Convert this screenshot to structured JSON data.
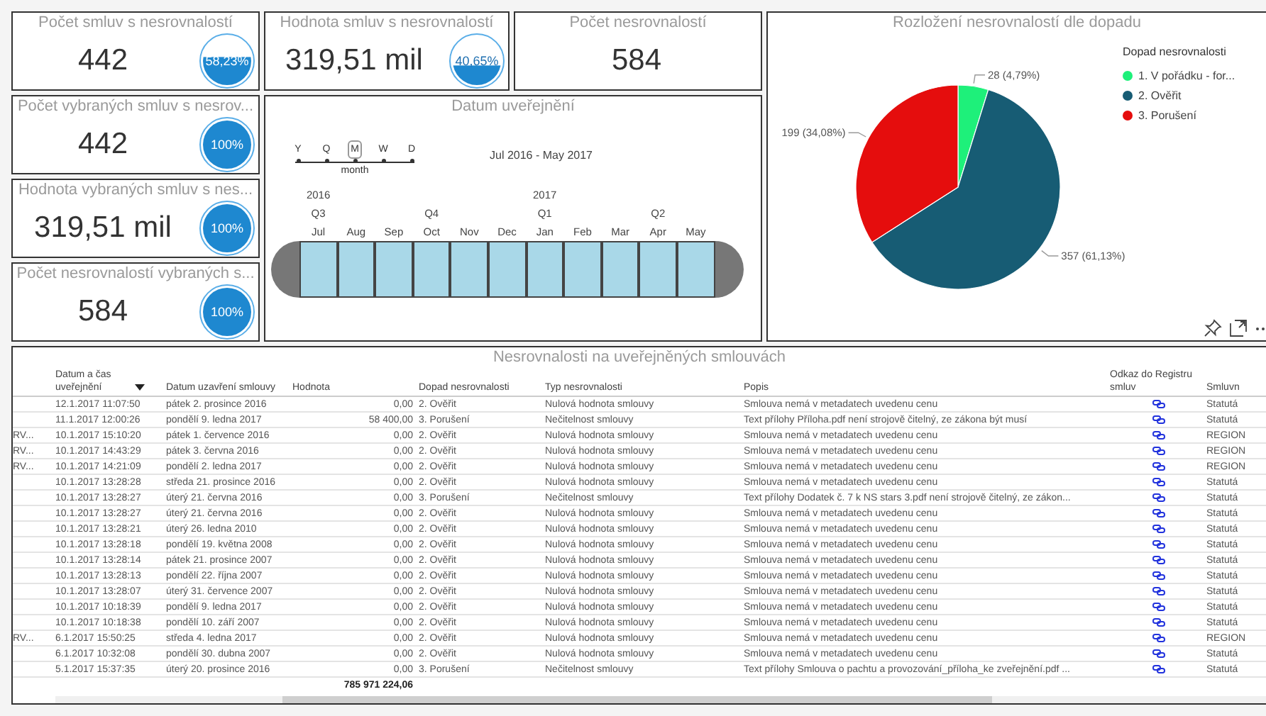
{
  "top_cards": [
    {
      "title": "Počet smluv s nesrovnalostí",
      "value": "442",
      "gauge": {
        "label": "58,23%"
      }
    },
    {
      "title": "Hodnota smluv s nesrovnalostí",
      "value": "319,51 mil",
      "gauge": {
        "label": "40,65%"
      }
    },
    {
      "title": "Počet nesrovnalostí",
      "value": "584"
    }
  ],
  "side_cards": [
    {
      "title": "Počet vybraných smluv s nesrov...",
      "value": "442",
      "gauge": {
        "label": "100%"
      }
    },
    {
      "title": "Hodnota vybraných smluv s nes...",
      "value": "319,51 mil",
      "gauge": {
        "label": "100%"
      }
    },
    {
      "title": "Počet nesrovnalostí vybraných s...",
      "value": "584",
      "gauge": {
        "label": "100%"
      }
    }
  ],
  "timeline": {
    "title": "Datum uveřejnění",
    "granularity": [
      {
        "label": "Y",
        "selected": false
      },
      {
        "label": "Q",
        "selected": false
      },
      {
        "label": "M",
        "selected": true
      },
      {
        "label": "W",
        "selected": false
      },
      {
        "label": "D",
        "selected": false
      }
    ],
    "granularity_caption": "month",
    "range": "Jul 2016 - May 2017",
    "months": [
      {
        "label": "Jul",
        "quarter": "Q3",
        "year": "2016",
        "selected": true
      },
      {
        "label": "Aug",
        "selected": true
      },
      {
        "label": "Sep",
        "selected": true
      },
      {
        "label": "Oct",
        "quarter": "Q4",
        "selected": true
      },
      {
        "label": "Nov",
        "selected": true
      },
      {
        "label": "Dec",
        "selected": true
      },
      {
        "label": "Jan",
        "quarter": "Q1",
        "year": "2017",
        "selected": true
      },
      {
        "label": "Feb",
        "selected": true
      },
      {
        "label": "Mar",
        "selected": true
      },
      {
        "label": "Apr",
        "quarter": "Q2",
        "selected": true
      },
      {
        "label": "May",
        "selected": true
      }
    ]
  },
  "pie": {
    "chart_data": {
      "type": "pie",
      "title": "Rozložení nesrovnalostí dle dopadu",
      "categories": [
        "1. V pořádku - for...",
        "2. Ověřit",
        "3. Porušení"
      ],
      "series": [
        {
          "name": "Dopad nesrovnalosti",
          "values": [
            4.79,
            61.13,
            34.08
          ]
        }
      ],
      "colors": [
        "#1ef07a",
        "#175c74",
        "#e50d0d"
      ],
      "value_labels": [
        "28 (4,79%)",
        "357 (61,13%)",
        "199 (34,08%)"
      ]
    }
  },
  "table": {
    "title": "Nesrovnalosti na uveřejněných smlouvách",
    "columns": [
      {
        "label": "Datum a čas uveřejnění",
        "sorted": true
      },
      {
        "label": "Datum uzavření smlouvy"
      },
      {
        "label": "Hodnota"
      },
      {
        "label": "Dopad nesrovnalosti"
      },
      {
        "label": "Typ nesrovnalosti"
      },
      {
        "label": "Popis"
      },
      {
        "label": "Odkaz do Registru smluv"
      },
      {
        "label": "Smluvn"
      }
    ],
    "rows": [
      {
        "cells": [
          "12.1.2017 11:07:50",
          "pátek 2. prosince 2016",
          "0,00",
          "2. Ověřit",
          "Nulová hodnota smlouvy",
          "Smlouva nemá v metadatech uvedenu cenu",
          "Statutá"
        ]
      },
      {
        "cells": [
          "11.1.2017 12:00:26",
          "pondělí 9. ledna 2017",
          "58 400,00",
          "3. Porušení",
          "Nečitelnost smlouvy",
          "Text přílohy Příloha.pdf není strojově čitelný, ze zákona být musí",
          "Statutá"
        ]
      },
      {
        "column_1": "RV...",
        "cells": [
          "10.1.2017 15:10:20",
          "pátek 1. července 2016",
          "0,00",
          "2. Ověřit",
          "Nulová hodnota smlouvy",
          "Smlouva nemá v metadatech uvedenu cenu",
          "REGION"
        ]
      },
      {
        "column_1": "RV...",
        "cells": [
          "10.1.2017 14:43:29",
          "pátek 3. června 2016",
          "0,00",
          "2. Ověřit",
          "Nulová hodnota smlouvy",
          "Smlouva nemá v metadatech uvedenu cenu",
          "REGION"
        ]
      },
      {
        "column_1": "RV...",
        "cells": [
          "10.1.2017 14:21:09",
          "pondělí 2. ledna 2017",
          "0,00",
          "2. Ověřit",
          "Nulová hodnota smlouvy",
          "Smlouva nemá v metadatech uvedenu cenu",
          "REGION"
        ]
      },
      {
        "cells": [
          "10.1.2017 13:28:28",
          "středa 21. prosince 2016",
          "0,00",
          "2. Ověřit",
          "Nulová hodnota smlouvy",
          "Smlouva nemá v metadatech uvedenu cenu",
          "Statutá"
        ]
      },
      {
        "cells": [
          "10.1.2017 13:28:27",
          "úterý 21. června 2016",
          "0,00",
          "3. Porušení",
          "Nečitelnost smlouvy",
          "Text přílohy Dodatek č. 7 k NS stars 3.pdf není strojově čitelný, ze zákon...",
          "Statutá"
        ]
      },
      {
        "cells": [
          "10.1.2017 13:28:27",
          "úterý 21. června 2016",
          "0,00",
          "2. Ověřit",
          "Nulová hodnota smlouvy",
          "Smlouva nemá v metadatech uvedenu cenu",
          "Statutá"
        ]
      },
      {
        "cells": [
          "10.1.2017 13:28:21",
          "úterý 26. ledna 2010",
          "0,00",
          "2. Ověřit",
          "Nulová hodnota smlouvy",
          "Smlouva nemá v metadatech uvedenu cenu",
          "Statutá"
        ]
      },
      {
        "cells": [
          "10.1.2017 13:28:18",
          "pondělí 19. května 2008",
          "0,00",
          "2. Ověřit",
          "Nulová hodnota smlouvy",
          "Smlouva nemá v metadatech uvedenu cenu",
          "Statutá"
        ]
      },
      {
        "cells": [
          "10.1.2017 13:28:14",
          "pátek 21. prosince 2007",
          "0,00",
          "2. Ověřit",
          "Nulová hodnota smlouvy",
          "Smlouva nemá v metadatech uvedenu cenu",
          "Statutá"
        ]
      },
      {
        "cells": [
          "10.1.2017 13:28:13",
          "pondělí 22. října 2007",
          "0,00",
          "2. Ověřit",
          "Nulová hodnota smlouvy",
          "Smlouva nemá v metadatech uvedenu cenu",
          "Statutá"
        ]
      },
      {
        "cells": [
          "10.1.2017 13:28:07",
          "úterý 31. července 2007",
          "0,00",
          "2. Ověřit",
          "Nulová hodnota smlouvy",
          "Smlouva nemá v metadatech uvedenu cenu",
          "Statutá"
        ]
      },
      {
        "cells": [
          "10.1.2017 10:18:39",
          "pondělí 9. ledna 2017",
          "0,00",
          "2. Ověřit",
          "Nulová hodnota smlouvy",
          "Smlouva nemá v metadatech uvedenu cenu",
          "Statutá"
        ]
      },
      {
        "cells": [
          "10.1.2017 10:18:38",
          "pondělí 10. září 2007",
          "0,00",
          "2. Ověřit",
          "Nulová hodnota smlouvy",
          "Smlouva nemá v metadatech uvedenu cenu",
          "Statutá"
        ]
      },
      {
        "column_1": "RV...",
        "cells": [
          "6.1.2017 15:50:25",
          "středa 4. ledna 2017",
          "0,00",
          "2. Ověřit",
          "Nulová hodnota smlouvy",
          "Smlouva nemá v metadatech uvedenu cenu",
          "REGION"
        ]
      },
      {
        "cells": [
          "6.1.2017 10:32:08",
          "pondělí 30. dubna 2007",
          "0,00",
          "2. Ověřit",
          "Nulová hodnota smlouvy",
          "Smlouva nemá v metadatech uvedenu cenu",
          "Statutá"
        ]
      },
      {
        "cells": [
          "5.1.2017 15:37:35",
          "úterý 20. prosince 2016",
          "0,00",
          "3. Porušení",
          "Nečitelnost smlouvy",
          "Text přílohy Smlouva o pachtu a provozování_příloha_ke zveřejnění.pdf ...",
          "Statutá"
        ]
      }
    ],
    "total": "785 971 224,06"
  }
}
